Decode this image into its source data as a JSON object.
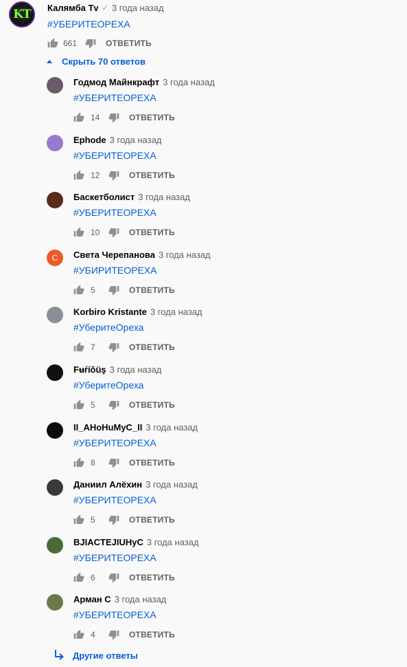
{
  "top_comment": {
    "avatar_text": "KT",
    "author": "Калямба Tv",
    "verified_mark": "✓",
    "time": "3 года назад",
    "text": "#УБЕРИТЕОРЕХА",
    "likes": "661",
    "reply_label": "ОТВЕТИТЬ"
  },
  "toggle_label": "Скрыть 70 ответов",
  "replies": [
    {
      "author": "Годмод Майнкрафт",
      "time": "3 года назад",
      "text": "#УБЕРИТЕОРЕХА",
      "likes": "14",
      "reply_label": "ОТВЕТИТЬ",
      "avatar_color": "#6a5a6a",
      "avatar_letter": ""
    },
    {
      "author": "Ephode",
      "time": "3 года назад",
      "text": "#УБЕРИТЕОРЕХА",
      "likes": "12",
      "reply_label": "ОТВЕТИТЬ",
      "avatar_color": "#9a7ad0",
      "avatar_letter": ""
    },
    {
      "author": "Баскетболист",
      "time": "3 года назад",
      "text": "#УБЕРИТЕОРЕХА",
      "likes": "10",
      "reply_label": "ОТВЕТИТЬ",
      "avatar_color": "#5a2a1a",
      "avatar_letter": ""
    },
    {
      "author": "Света Черепанова",
      "time": "3 года назад",
      "text": "#УБИРИТЕОРЕХА",
      "likes": "5",
      "reply_label": "ОТВЕТИТЬ",
      "avatar_color": "#ef5a28",
      "avatar_letter": "С"
    },
    {
      "author": "Korbiro Kristante",
      "time": "3 года назад",
      "text": "#УберитеОреха",
      "likes": "7",
      "reply_label": "ОТВЕТИТЬ",
      "avatar_color": "#8a8f98",
      "avatar_letter": ""
    },
    {
      "author": "Fʉŕíŏüş",
      "time": "3 года назад",
      "text": "#УберитеОреха",
      "likes": "5",
      "reply_label": "ОТВЕТИТЬ",
      "avatar_color": "#111111",
      "avatar_letter": ""
    },
    {
      "author": "II_AHoHuMyC_II",
      "time": "3 года назад",
      "text": "#УБЕРИТЕОРЕХА",
      "likes": "8",
      "reply_label": "ОТВЕТИТЬ",
      "avatar_color": "#0a0a0a",
      "avatar_letter": ""
    },
    {
      "author": "Даниил Алёхин",
      "time": "3 года назад",
      "text": "#УБЕРИТЕОРЕХА",
      "likes": "5",
      "reply_label": "ОТВЕТИТЬ",
      "avatar_color": "#3a3a3a",
      "avatar_letter": ""
    },
    {
      "author": "BJIACTEJIUHyC",
      "time": "3 года назад",
      "text": "#УБЕРИТЕОРЕХА",
      "likes": "6",
      "reply_label": "ОТВЕТИТЬ",
      "avatar_color": "#4a6a3a",
      "avatar_letter": ""
    },
    {
      "author": "Арман С",
      "time": "3 года назад",
      "text": "#УБЕРИТЕОРЕХА",
      "likes": "4",
      "reply_label": "ОТВЕТИТЬ",
      "avatar_color": "#6a7a4a",
      "avatar_letter": ""
    }
  ],
  "more_replies_label": "Другие ответы",
  "colors": {
    "link": "#065fd4",
    "meta": "#606060",
    "background": "#f9f9f9"
  }
}
